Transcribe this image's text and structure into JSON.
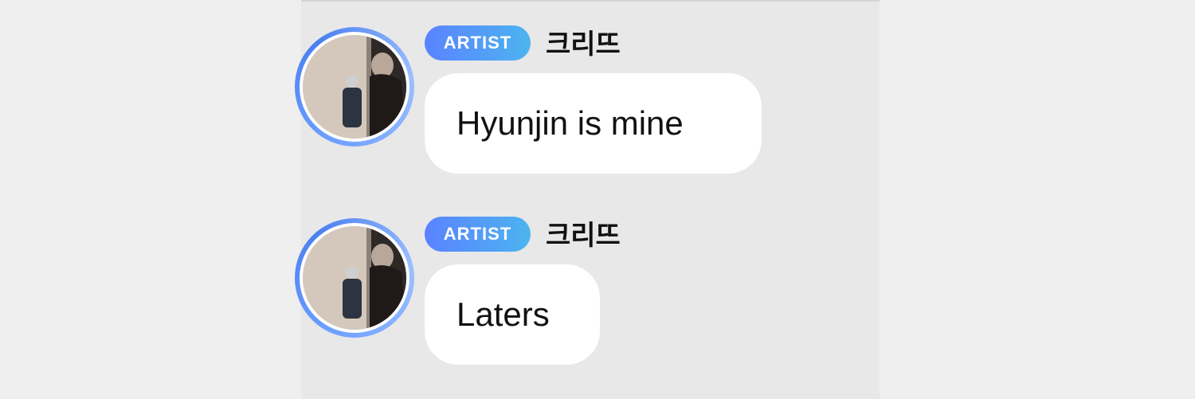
{
  "messages": [
    {
      "badge": "ARTIST",
      "sender": "크리뜨",
      "text": "Hyunjin is mine"
    },
    {
      "badge": "ARTIST",
      "sender": "크리뜨",
      "text": "Laters"
    }
  ],
  "colors": {
    "badge_start": "#5a82ff",
    "badge_end": "#4db4f0",
    "avatar_ring": "#6fa0ff",
    "bubble": "#ffffff",
    "background": "#efefef"
  },
  "icons": {
    "avatar": "profile-photo"
  }
}
